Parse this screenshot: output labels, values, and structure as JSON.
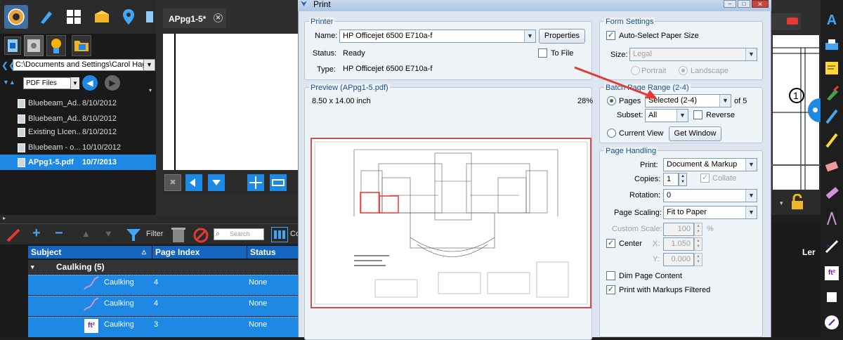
{
  "left_panel": {
    "path": "C:\\Documents and Settings\\Carol  Hage",
    "file_filter": "PDF Files",
    "files": [
      {
        "name": "Bluebeam_Ad...",
        "date": "8/10/2012"
      },
      {
        "name": "Bluebeam_Ad...",
        "date": "8/10/2012"
      },
      {
        "name": "Existing LIcen...",
        "date": "8/10/2012"
      },
      {
        "name": "Bluebeam - o...",
        "date": "10/10/2012"
      },
      {
        "name": "APpg1-5.pdf",
        "date": "10/7/2013"
      }
    ]
  },
  "document": {
    "tab_label": "APpg1-5*"
  },
  "markups": {
    "filter_label": "Filter",
    "search_placeholder": "Search",
    "columns_label": "Co",
    "headers": {
      "subject": "Subject",
      "page_index": "Page Index",
      "status": "Status",
      "len": "Ler"
    },
    "group": "Caulking (5)",
    "rows": [
      {
        "subject": "Caulking",
        "page_index": "4",
        "status": "None"
      },
      {
        "subject": "Caulking",
        "page_index": "4",
        "status": "None"
      },
      {
        "subject": "Caulking",
        "page_index": "3",
        "status": "None"
      }
    ]
  },
  "dialog": {
    "title": "Print",
    "printer": {
      "group_title": "Printer",
      "name_label": "Name:",
      "name_value": "HP Officejet 6500 E710a-f",
      "properties_label": "Properties",
      "to_file_label": "To File",
      "status_label": "Status:",
      "status_value": "Ready",
      "type_label": "Type:",
      "type_value": "HP Officejet 6500 E710a-f"
    },
    "preview": {
      "group_title": "Preview (APpg1-5.pdf)",
      "size": "8.50 x 14.00 inch",
      "zoom": "28%"
    },
    "form_settings": {
      "group_title": "Form Settings",
      "auto_select_label": "Auto-Select Paper Size",
      "size_label": "Size:",
      "size_value": "Legal",
      "portrait_label": "Portrait",
      "landscape_label": "Landscape"
    },
    "batch_range": {
      "group_title": "Batch Page Range (2-4)",
      "pages_label": "Pages",
      "pages_value": "Selected (2-4)",
      "of_label": "of 5",
      "subset_label": "Subset:",
      "subset_value": "All",
      "reverse_label": "Reverse",
      "current_view_label": "Current View",
      "get_window_label": "Get Window"
    },
    "page_handling": {
      "group_title": "Page Handling",
      "print_label": "Print:",
      "print_value": "Document & Markup",
      "copies_label": "Copies:",
      "copies_value": "1",
      "collate_label": "Collate",
      "rotation_label": "Rotation:",
      "rotation_value": "0",
      "scaling_label": "Page Scaling:",
      "scaling_value": "Fit to Paper",
      "custom_scale_label": "Custom Scale:",
      "custom_scale_value": "100",
      "percent": "%",
      "center_label": "Center",
      "x_label": "X:",
      "x_value": "1.050",
      "y_label": "Y:",
      "y_value": "0.000",
      "dim_label": "Dim Page Content",
      "filtered_label": "Print with Markups Filtered"
    }
  },
  "colors": {
    "accent_blue": "#1e88e5",
    "annotation_red": "#e53935"
  }
}
